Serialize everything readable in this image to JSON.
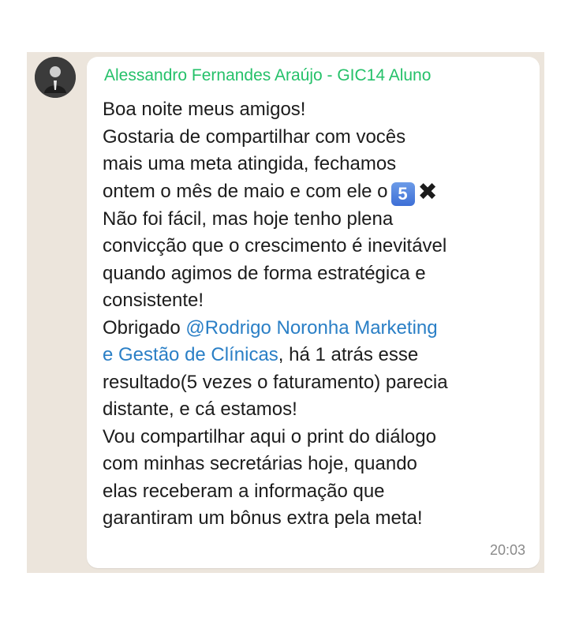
{
  "sender": {
    "name": "Alessandro Fernandes Araújo - GIC14 Aluno",
    "color": "#25c16a"
  },
  "message": {
    "line1": "Boa noite meus amigos!",
    "line2": "Gostaria de compartilhar com vocês",
    "line3": "mais uma meta atingida, fechamos",
    "line4": "ontem o mês de maio e com ele o",
    "emoji_five": "5",
    "emoji_x": "✖",
    "line5": "Não foi fácil, mas hoje tenho plena",
    "line6": "convicção que o crescimento é inevitável",
    "line7": "quando agimos de forma estratégica e",
    "line8": "consistente!",
    "line9_prefix": "Obrigado ",
    "mention_part1": "@Rodrigo Noronha Marketing",
    "mention_part2": "e Gestão de Clínicas",
    "line10_suffix": ", há 1 atrás esse",
    "line11": "resultado(5 vezes o faturamento) parecia",
    "line12": "distante, e cá estamos!",
    "line13": "Vou compartilhar aqui o print do diálogo",
    "line14": "com minhas secretárias hoje, quando",
    "line15": "elas receberam a informação que",
    "line16": "garantiram um bônus extra pela meta!"
  },
  "timestamp": "20:03",
  "colors": {
    "mention": "#2a7fc6",
    "chat_background": "#ece5dc",
    "bubble": "#ffffff"
  }
}
